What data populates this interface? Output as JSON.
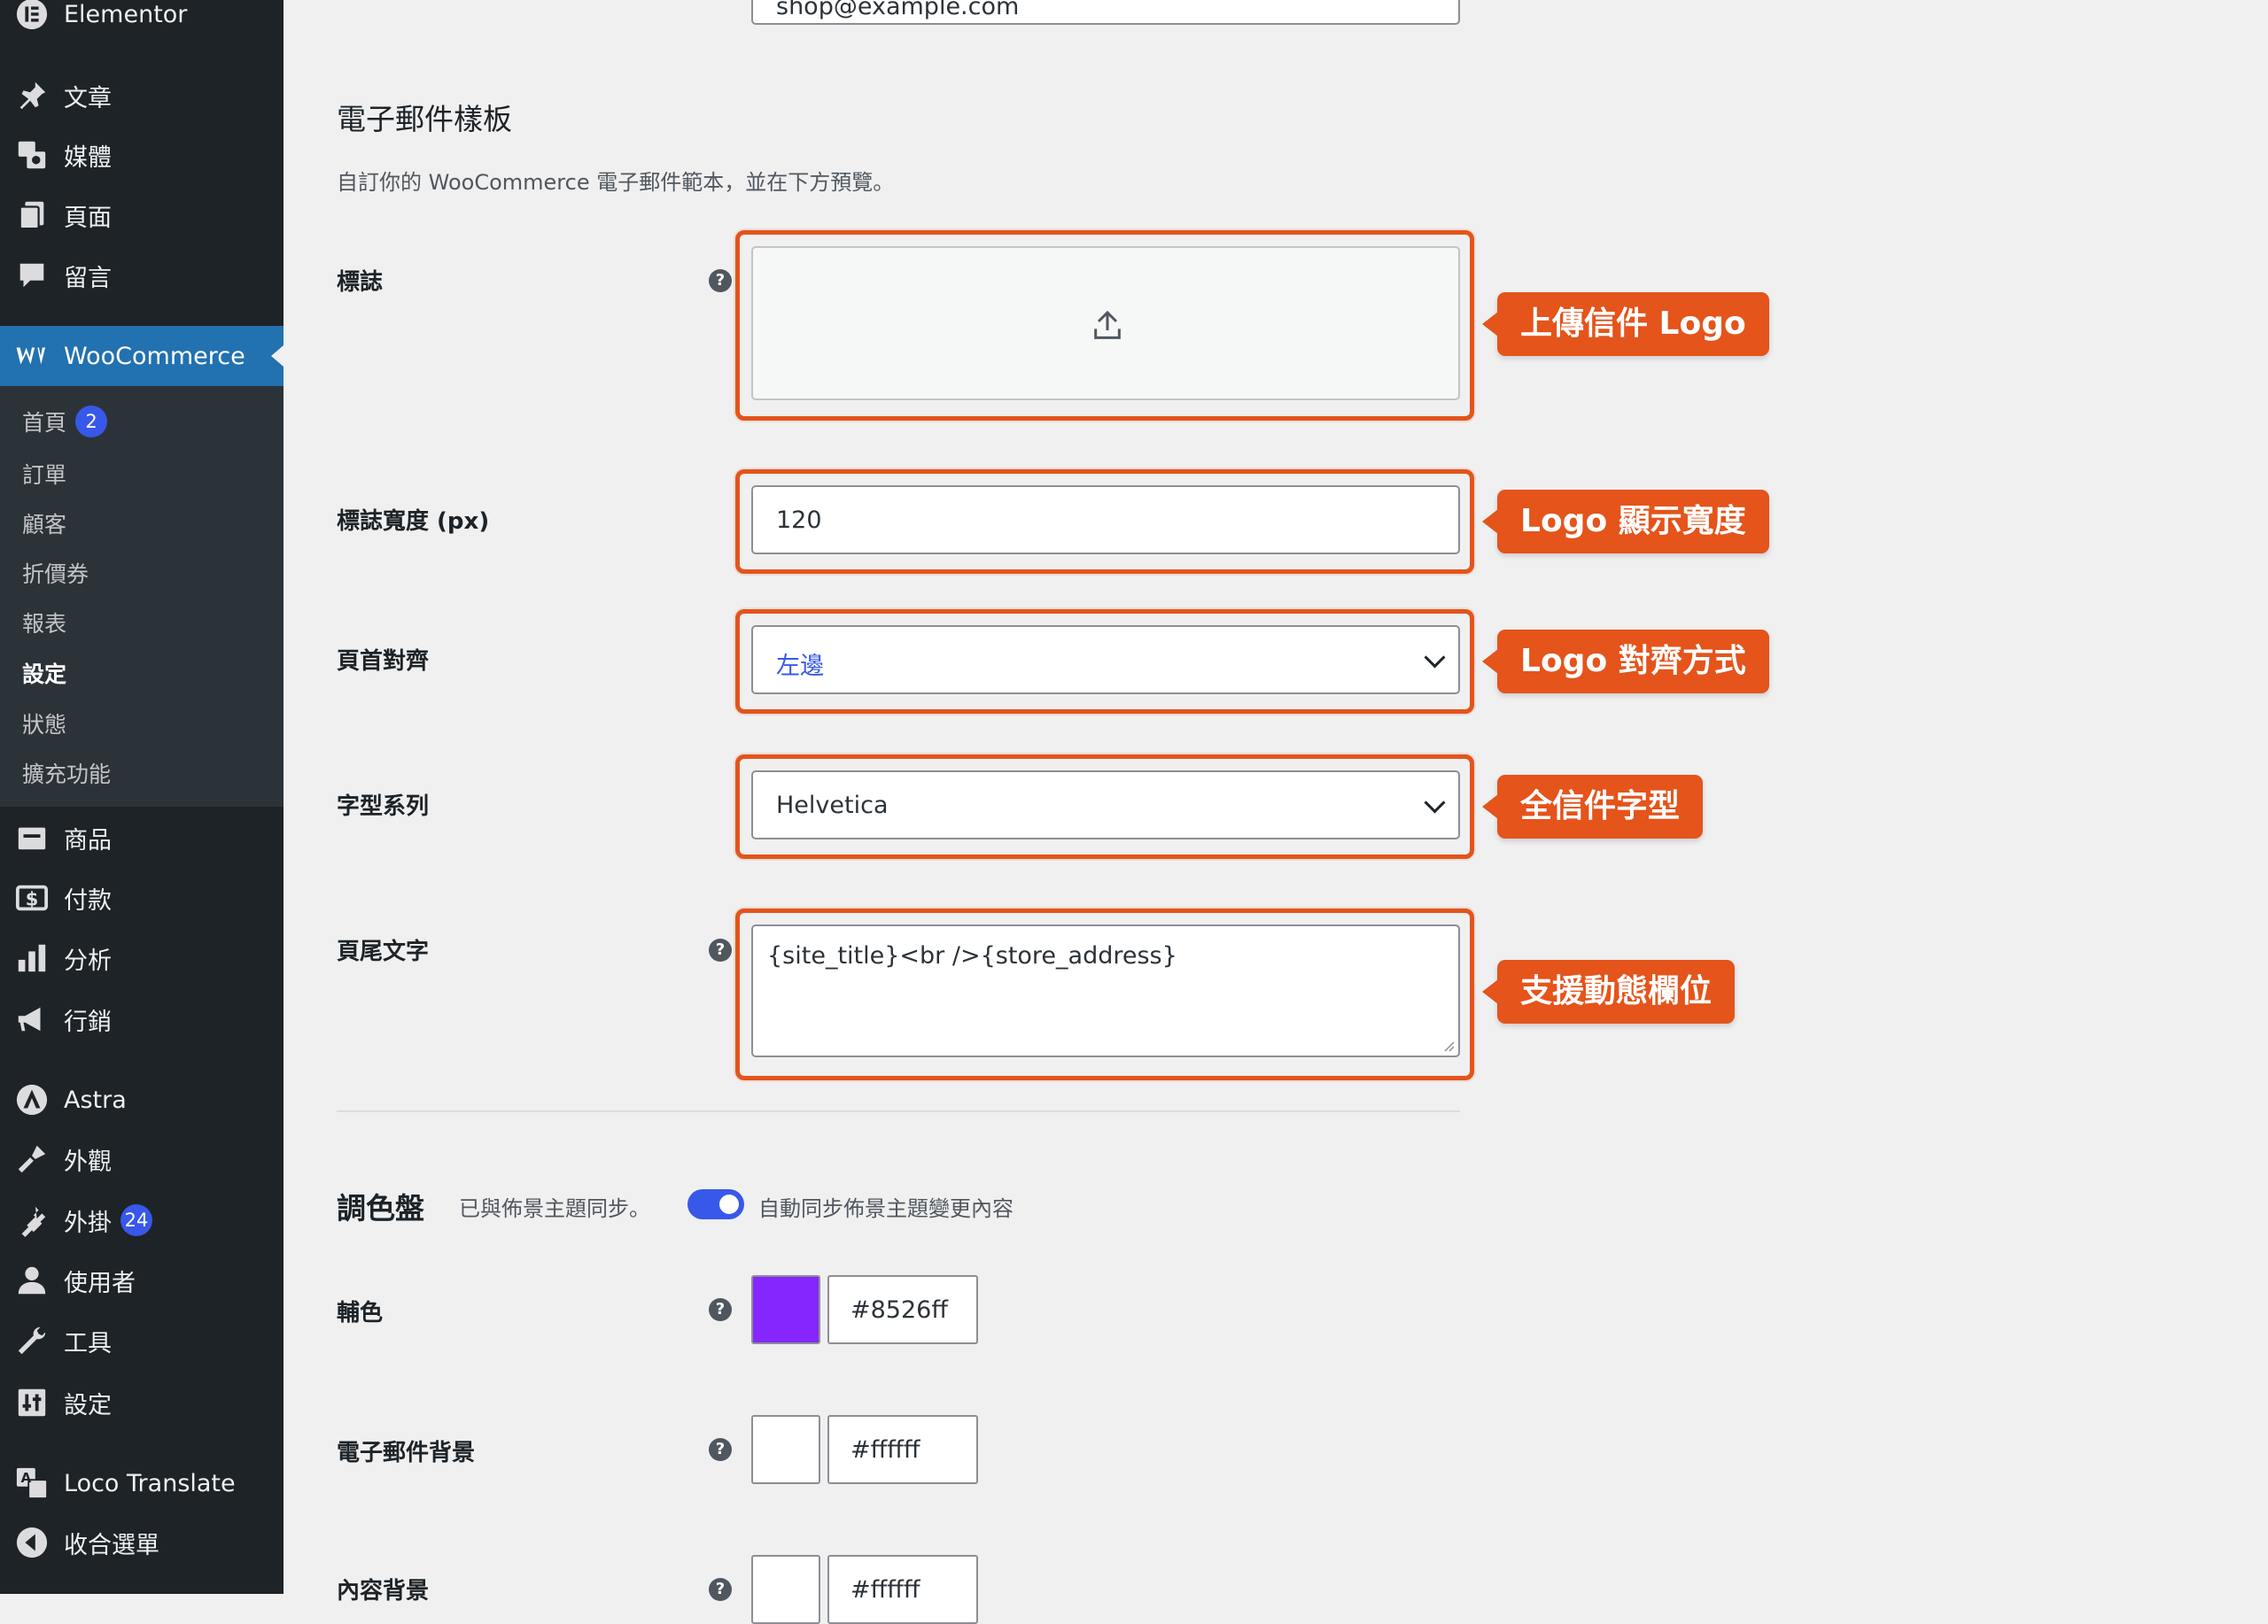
{
  "sidebar": {
    "top_items": [
      {
        "label": "Elementor",
        "icon": "elementor-icon"
      },
      {
        "label": "文章",
        "icon": "pin-icon"
      },
      {
        "label": "媒體",
        "icon": "media-icon"
      },
      {
        "label": "頁面",
        "icon": "pages-icon"
      },
      {
        "label": "留言",
        "icon": "comments-icon"
      }
    ],
    "woocommerce": {
      "label": "WooCommerce",
      "icon": "woocommerce-icon"
    },
    "submenu": [
      {
        "label": "首頁",
        "badge": "2"
      },
      {
        "label": "訂單"
      },
      {
        "label": "顧客"
      },
      {
        "label": "折價券"
      },
      {
        "label": "報表"
      },
      {
        "label": "設定",
        "current": true
      },
      {
        "label": "狀態"
      },
      {
        "label": "擴充功能"
      }
    ],
    "bottom_items": [
      {
        "label": "商品",
        "icon": "products-icon"
      },
      {
        "label": "付款",
        "icon": "payments-icon"
      },
      {
        "label": "分析",
        "icon": "analytics-icon"
      },
      {
        "label": "行銷",
        "icon": "marketing-icon"
      },
      {
        "label": "Astra",
        "icon": "astra-icon"
      },
      {
        "label": "外觀",
        "icon": "appearance-icon"
      },
      {
        "label": "外掛",
        "icon": "plugins-icon",
        "badge": "24"
      },
      {
        "label": "使用者",
        "icon": "users-icon"
      },
      {
        "label": "工具",
        "icon": "tools-icon"
      },
      {
        "label": "設定",
        "icon": "settings-icon"
      },
      {
        "label": "Loco Translate",
        "icon": "translate-icon"
      },
      {
        "label": "收合選單",
        "icon": "collapse-icon"
      }
    ]
  },
  "main": {
    "top_email_value": "shop@example.com",
    "email_template": {
      "title": "電子郵件樣板",
      "description": "自訂你的 WooCommerce 電子郵件範本，並在下方預覽。",
      "fields": {
        "logo": {
          "label": "標誌"
        },
        "logo_width": {
          "label": "標誌寬度 (px)",
          "value": "120"
        },
        "header_alignment": {
          "label": "頁首對齊",
          "value": "左邊"
        },
        "font_family": {
          "label": "字型系列",
          "value": "Helvetica"
        },
        "footer_text": {
          "label": "頁尾文字",
          "value": "{site_title}<br />{store_address}"
        }
      }
    },
    "callouts": {
      "logo": "上傳信件 Logo",
      "logo_width": "Logo 顯示寬度",
      "alignment": "Logo 對齊方式",
      "font": "全信件字型",
      "footer": "支援動態欄位"
    },
    "palette": {
      "title": "調色盤",
      "synced_text": "已與佈景主題同步。",
      "toggle_label": "自動同步佈景主題變更內容",
      "toggle_on": true,
      "rows": [
        {
          "label": "輔色",
          "hex": "#8526ff",
          "color": "#8526ff"
        },
        {
          "label": "電子郵件背景",
          "hex": "#ffffff",
          "color": "#ffffff"
        },
        {
          "label": "內容背景",
          "hex": "#ffffff",
          "color": "#ffffff"
        }
      ]
    }
  },
  "colors": {
    "sidebar_bg": "#1d2327",
    "submenu_bg": "#2c3338",
    "active_blue": "#2271b1",
    "highlight_orange": "#e4541b",
    "toggle_blue": "#3858e9"
  }
}
